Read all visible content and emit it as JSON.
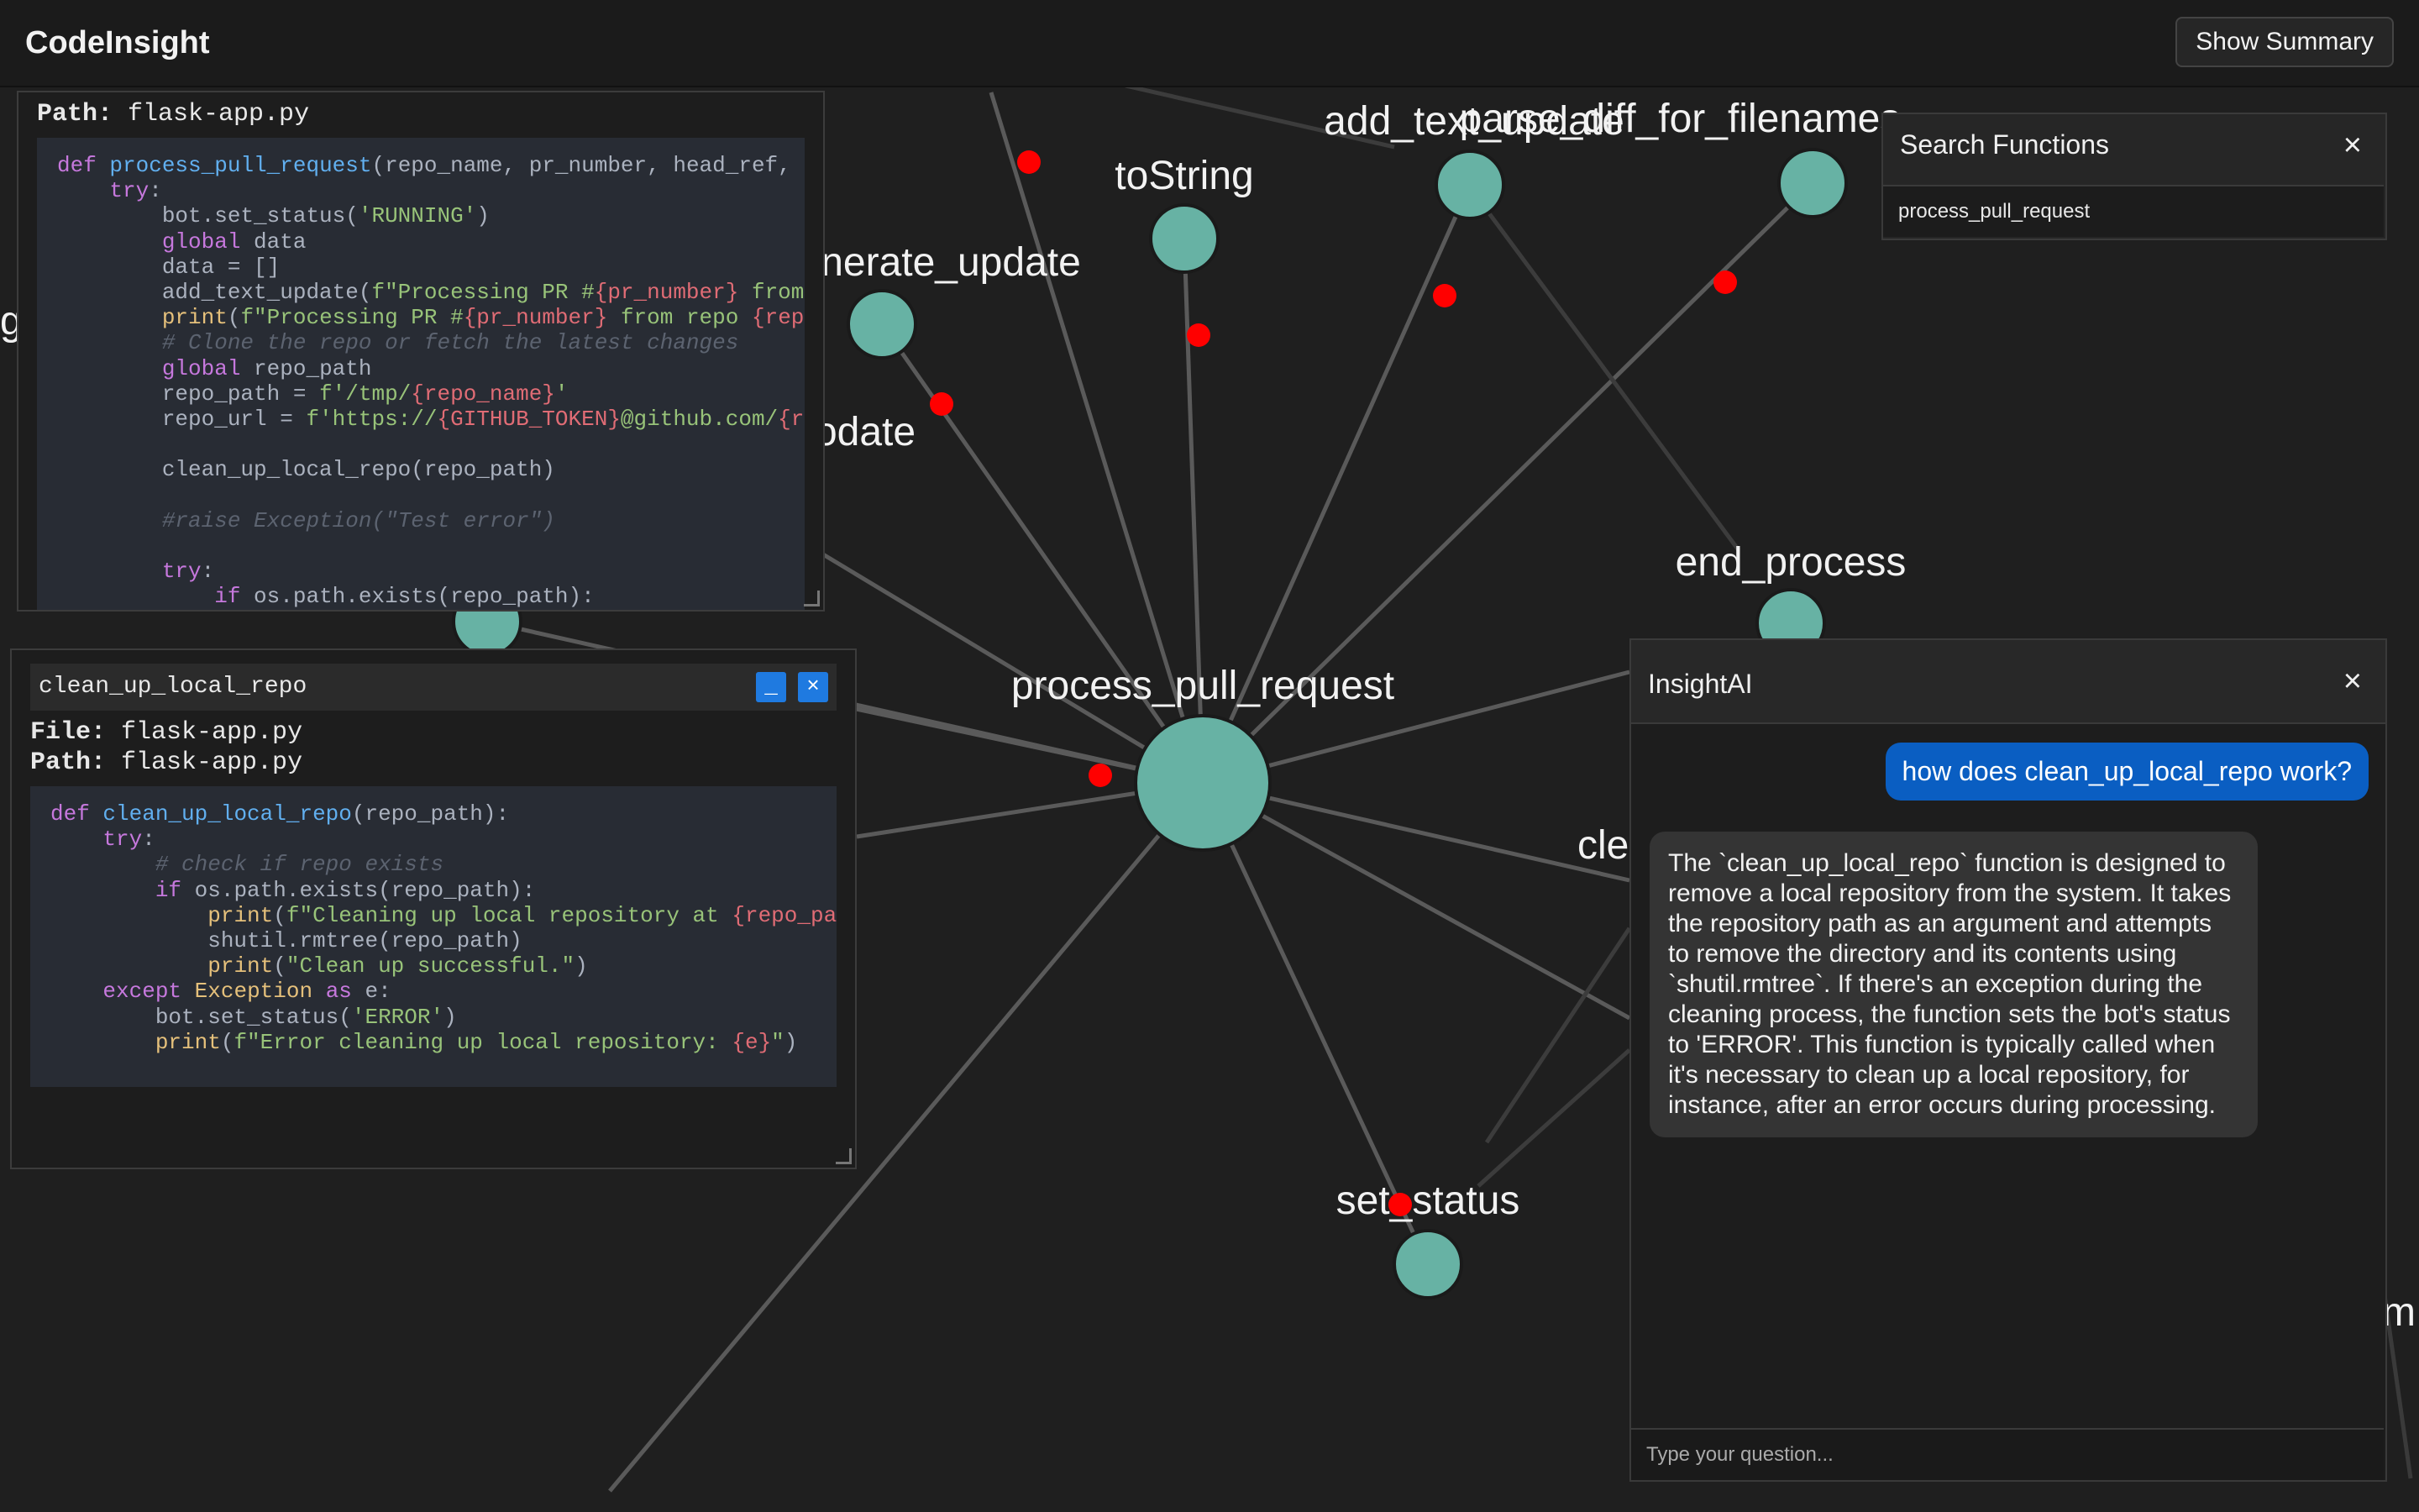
{
  "header": {
    "brand": "CodeInsight",
    "summary_button": "Show Summary"
  },
  "graph": {
    "center": "process_pull_request",
    "labels": {
      "add_text_update": "add_text_update",
      "parse_diff_for_filenames": "parse_diff_for_filenames",
      "toString": "toString",
      "generate_update": "nerate_update",
      "update": "odate",
      "end_process": "end_process",
      "clean": "cle",
      "set_status": "set_status",
      "left_edge": "g",
      "right_edge": "m"
    }
  },
  "panel_process": {
    "path_label": "Path:",
    "path_value": "flask-app.py",
    "code_lines": [
      "def process_pull_request(repo_name, pr_number, head_ref,",
      "    try:",
      "        bot.set_status('RUNNING')",
      "        global data",
      "        data = []",
      "        add_text_update(f\"Processing PR #{pr_number} from",
      "        print(f\"Processing PR #{pr_number} from repo {rep",
      "        # Clone the repo or fetch the latest changes",
      "        global repo_path",
      "        repo_path = f'/tmp/{repo_name}'",
      "        repo_url = f'https://{GITHUB_TOKEN}@github.com/{r",
      "",
      "        clean_up_local_repo(repo_path)",
      "",
      "        #raise Exception(\"Test error\")",
      "",
      "        try:",
      "            if os.path.exists(repo_path):"
    ]
  },
  "panel_cleanup": {
    "title": "clean_up_local_repo",
    "minimize": "_",
    "close": "×",
    "file_label": "File:",
    "file_value": "flask-app.py",
    "path_label": "Path:",
    "path_value": "flask-app.py",
    "code_lines": [
      "def clean_up_local_repo(repo_path):",
      "    try:",
      "        # check if repo exists",
      "        if os.path.exists(repo_path):",
      "            print(f\"Cleaning up local repository at {repo_pa",
      "            shutil.rmtree(repo_path)",
      "            print(\"Clean up successful.\")",
      "    except Exception as e:",
      "        bot.set_status('ERROR')",
      "        print(f\"Error cleaning up local repository: {e}\")"
    ]
  },
  "search": {
    "title": "Search Functions",
    "close": "×",
    "value": "process_pull_request"
  },
  "insight": {
    "title": "InsightAI",
    "close": "×",
    "user_message": "how does clean_up_local_repo work?",
    "bot_message": "The `clean_up_local_repo` function is designed to remove a local repository from the system. It takes the repository path as an argument and attempts to remove the directory and its contents using `shutil.rmtree`. If there's an exception during the cleaning process, the function sets the bot's status to 'ERROR'. This function is typically called when it's necessary to clean up a local repository, for instance, after an error occurs during processing.",
    "input_placeholder": "Type your question..."
  },
  "colors": {
    "node": "#67b2a4",
    "edge": "#5a5a5a",
    "marker": "#ff0000",
    "accent": "#0a5ec2"
  }
}
